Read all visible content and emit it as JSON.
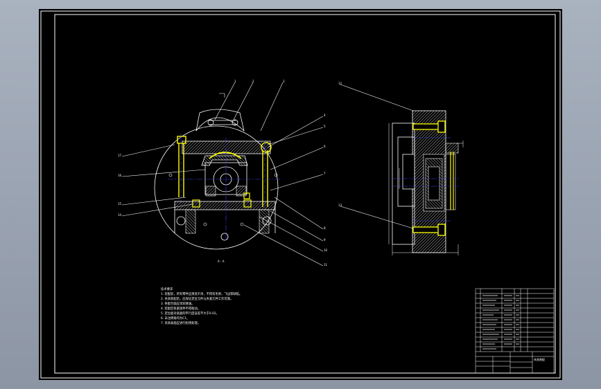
{
  "drawing": {
    "front_view_label": "A - A",
    "notes_heading": "技术要求",
    "notes": [
      "1. 装配前，所有零件应清洗干净，不得有毛刺、飞边等缺陷。",
      "2. 夹具装配后，应保证定位元件与夹紧元件工作可靠。",
      "3. 各配合面应涂润滑油。",
      "4. 装配后各紧固件不得松动。",
      "5. 定位面对底面的平行度误差不大于0.02。",
      "6. 未注倒角均为C1。",
      "7. 夹具表面应进行防锈处理。"
    ],
    "title_block": {
      "title": "夹具装配",
      "drawing_no": "",
      "scale": ""
    }
  },
  "colors": {
    "background": "#000000",
    "frame": "#ffffff",
    "leader": "#ffffff",
    "section_hatch": "#ffffff",
    "part": "#ffff00",
    "axis": "#4040ff"
  }
}
